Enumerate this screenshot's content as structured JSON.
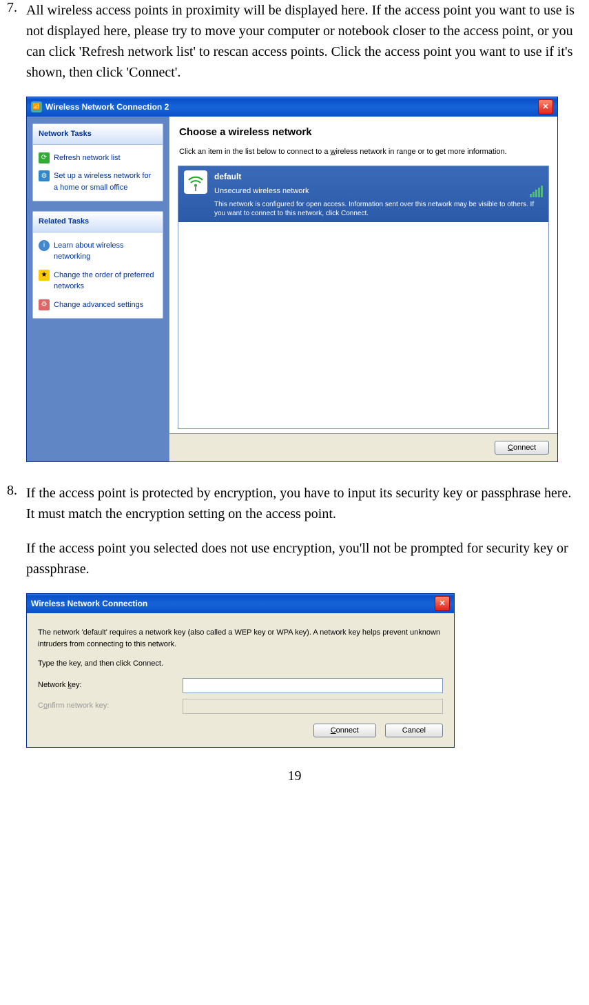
{
  "steps": {
    "s7": {
      "num": "7.",
      "text": "All wireless access points in proximity will be displayed here. If the access point you want to use is not displayed here, please try to move your computer or notebook closer to the access point, or you can click 'Refresh network list' to rescan access points. Click the access point you want to use if it's shown, then click 'Connect'."
    },
    "s8": {
      "num": "8.",
      "p1": "If the access point is protected by encryption, you have to input its security key or passphrase here. It must match the encryption setting on the access point.",
      "p2": "If the access point you selected does not use encryption, you'll not be prompted for security key or passphrase."
    }
  },
  "dlg1": {
    "title": "Wireless Network Connection 2",
    "sidebar": {
      "panel1": {
        "header": "Network Tasks",
        "items": [
          {
            "label": "Refresh network list"
          },
          {
            "label": "Set up a wireless network for a home or small office"
          }
        ]
      },
      "panel2": {
        "header": "Related Tasks",
        "items": [
          {
            "label": "Learn about wireless networking"
          },
          {
            "label": "Change the order of preferred networks"
          },
          {
            "label": "Change advanced settings"
          }
        ]
      }
    },
    "main": {
      "heading": "Choose a wireless network",
      "sub_pre": "Click an item in the list below to connect to a ",
      "sub_u": "w",
      "sub_post": "ireless network in range or to get more information.",
      "network": {
        "name": "default",
        "status": "Unsecured wireless network",
        "msg": "This network is configured for open access. Information sent over this network may be visible to others. If you want to connect to this network, click Connect."
      },
      "connect_label": "Connect"
    }
  },
  "dlg2": {
    "title": "Wireless Network Connection",
    "msg": "The network 'default' requires a network key (also called a WEP key or WPA key). A network key helps prevent unknown intruders from connecting to this network.",
    "instruction": "Type the key, and then click Connect.",
    "field1_label": "Network key:",
    "field1_value": "",
    "field2_label": "Confirm network key:",
    "connect_label": "Connect",
    "cancel_label": "Cancel"
  },
  "page_number": "19"
}
